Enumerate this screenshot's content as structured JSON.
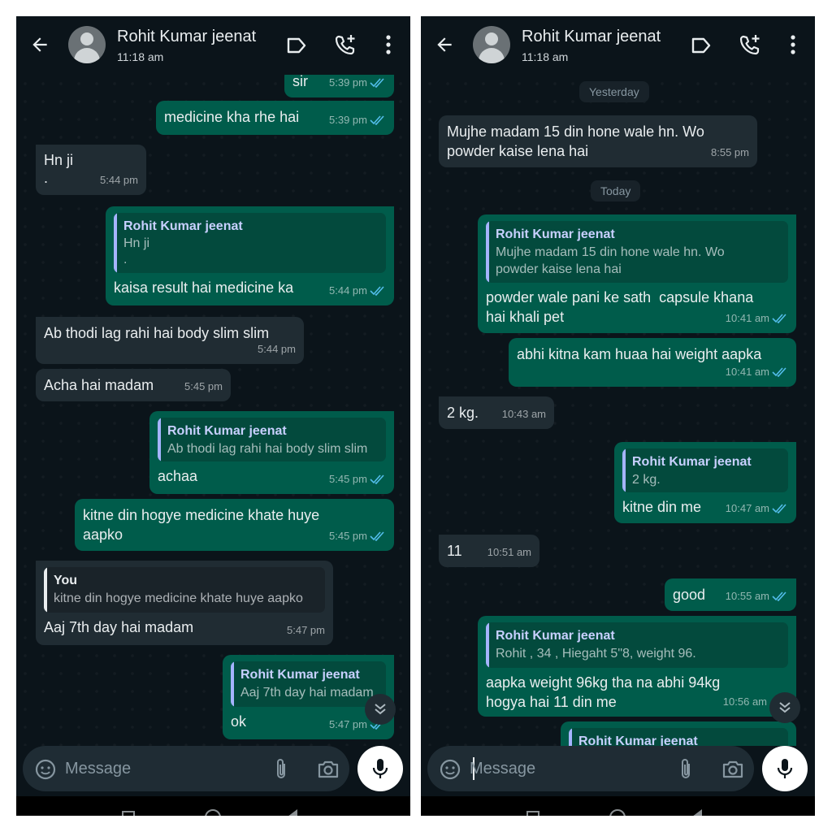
{
  "contact": {
    "name": "Rohit Kumar jeenat",
    "status": "11:18 am"
  },
  "input": {
    "placeholder": "Message"
  },
  "colors": {
    "bg": "#0b141a",
    "incoming": "#202c33",
    "outgoing": "#005c4b",
    "ticks": "#53bdeb",
    "quote_name_out": "#c8d0ff"
  },
  "icons": [
    "back-arrow-icon",
    "label-icon",
    "add-call-icon",
    "more-vert-icon",
    "sticker-icon",
    "attach-icon",
    "camera-icon",
    "mic-icon",
    "chevron-down-icon"
  ],
  "left": {
    "messages": [
      {
        "text": "sir",
        "time": "5:39 pm"
      },
      {
        "text": "medicine kha rhe hai",
        "time": "5:39 pm"
      },
      {
        "text": "Hn ji\n.",
        "time": "5:44 pm"
      },
      {
        "quote_author": "Rohit Kumar jeenat",
        "quote_text": "Hn ji\n.",
        "text": "kaisa result hai medicine ka",
        "time": "5:44 pm"
      },
      {
        "text": "Ab thodi lag rahi hai body slim slim",
        "time": "5:44 pm"
      },
      {
        "text": "Acha hai madam",
        "time": "5:45 pm"
      },
      {
        "quote_author": "Rohit Kumar jeenat",
        "quote_text": "Ab thodi lag rahi hai body slim slim",
        "text": "achaa",
        "time": "5:45 pm"
      },
      {
        "text": "kitne din hogye medicine khate huye\naapko",
        "time": "5:45 pm"
      },
      {
        "quote_author": "You",
        "quote_text": "kitne din hogye medicine khate huye aapko",
        "text": "Aaj 7th day hai madam",
        "time": "5:47 pm"
      },
      {
        "quote_author": "Rohit Kumar jeenat",
        "quote_text": "Aaj 7th day hai madam",
        "text": "ok",
        "time": "5:47 pm"
      }
    ]
  },
  "right": {
    "date_yesterday": "Yesterday",
    "date_today": "Today",
    "messages": [
      {
        "text": "Mujhe madam 15 din hone wale hn. Wo\npowder kaise lena hai",
        "time": "8:55 pm"
      },
      {
        "quote_author": "Rohit Kumar jeenat",
        "quote_text": "Mujhe madam 15 din hone wale hn. Wo\npowder kaise lena hai",
        "text": "powder wale pani ke sath  capsule khana\nhai khali pet",
        "time": "10:41 am"
      },
      {
        "text": "abhi kitna kam huaa hai weight aapka",
        "time": "10:41 am"
      },
      {
        "text": "2 kg.",
        "time": "10:43 am"
      },
      {
        "quote_author": "Rohit Kumar jeenat",
        "quote_text": "2 kg.",
        "text": "kitne din me",
        "time": "10:47 am"
      },
      {
        "text": "11",
        "time": "10:51 am"
      },
      {
        "text": "good",
        "time": "10:55 am"
      },
      {
        "quote_author": "Rohit Kumar jeenat",
        "quote_text": "Rohit , 34 , Hiegaht  5\"8, weight 96.",
        "text": "aapka weight 96kg tha na abhi 94kg\nhogya hai 11 din me",
        "time": "10:56 am"
      },
      {
        "quote_author": "Rohit Kumar jeenat"
      }
    ]
  }
}
